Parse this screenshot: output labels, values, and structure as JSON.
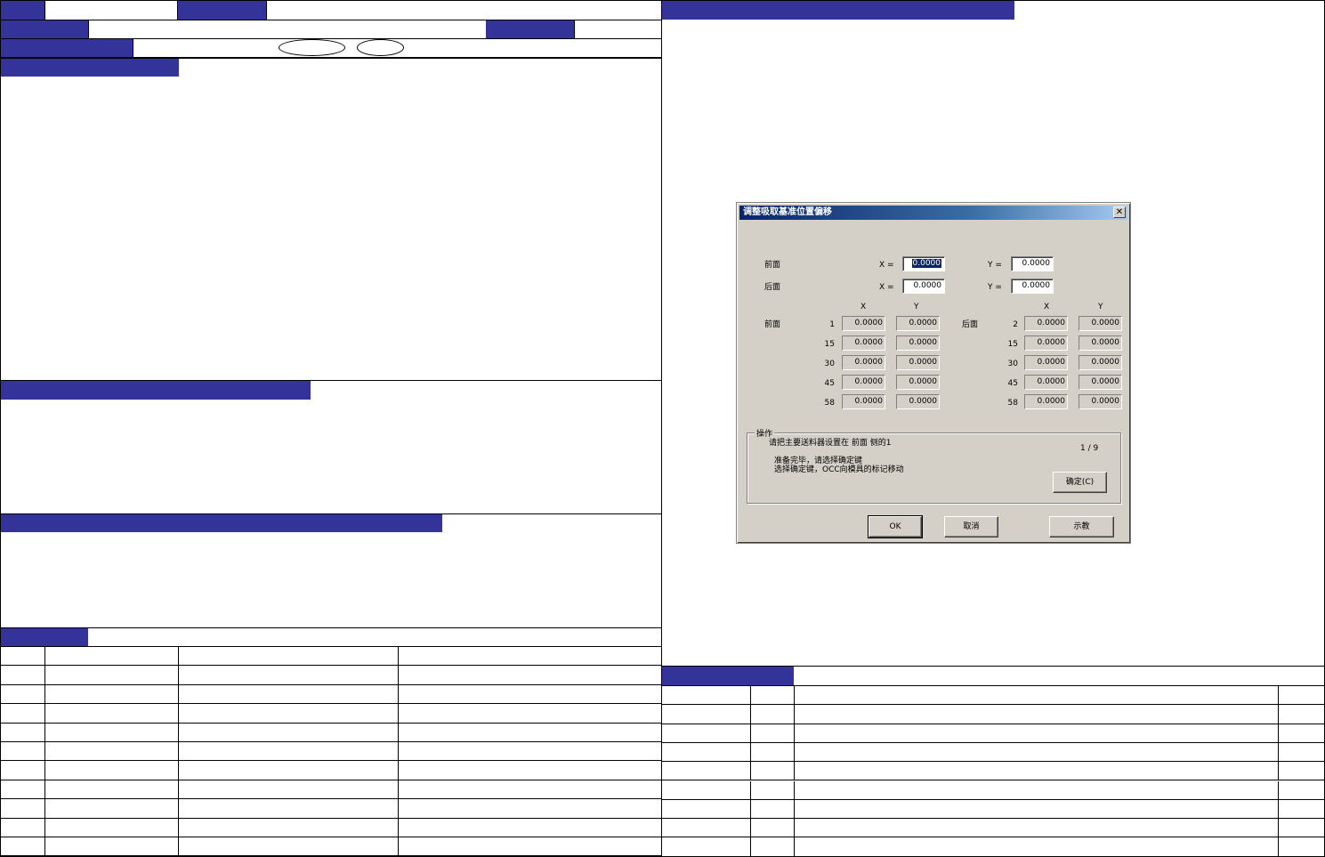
{
  "dialog": {
    "title": "调整吸取基准位置偏移",
    "close": "✕",
    "front_label": "前面",
    "back_label": "后面",
    "x_eq": "X =",
    "y_eq": "Y =",
    "front_x": "0.0000",
    "front_y": "0.0000",
    "back_x": "0.0000",
    "back_y": "0.0000",
    "col_x": "X",
    "col_y": "Y",
    "front_rows": [
      {
        "n": "1",
        "x": "0.0000",
        "y": "0.0000"
      },
      {
        "n": "15",
        "x": "0.0000",
        "y": "0.0000"
      },
      {
        "n": "30",
        "x": "0.0000",
        "y": "0.0000"
      },
      {
        "n": "45",
        "x": "0.0000",
        "y": "0.0000"
      },
      {
        "n": "58",
        "x": "0.0000",
        "y": "0.0000"
      }
    ],
    "back_rows": [
      {
        "n": "2",
        "x": "0.0000",
        "y": "0.0000"
      },
      {
        "n": "15",
        "x": "0.0000",
        "y": "0.0000"
      },
      {
        "n": "30",
        "x": "0.0000",
        "y": "0.0000"
      },
      {
        "n": "45",
        "x": "0.0000",
        "y": "0.0000"
      },
      {
        "n": "58",
        "x": "0.0000",
        "y": "0.0000"
      }
    ],
    "operation": {
      "title": "操作",
      "line1": "请把主要送料器设置在 前面 侧的1",
      "progress": "1 / 9",
      "line2": "准备完毕，请选择确定键",
      "line3": "选择确定键，OCC向模具的标记移动",
      "confirm": "确定(C)"
    },
    "ok": "OK",
    "cancel": "取消",
    "teach": "示教"
  },
  "colors": {
    "navy": "#333399",
    "dialog_bg": "#d4d0c8"
  }
}
